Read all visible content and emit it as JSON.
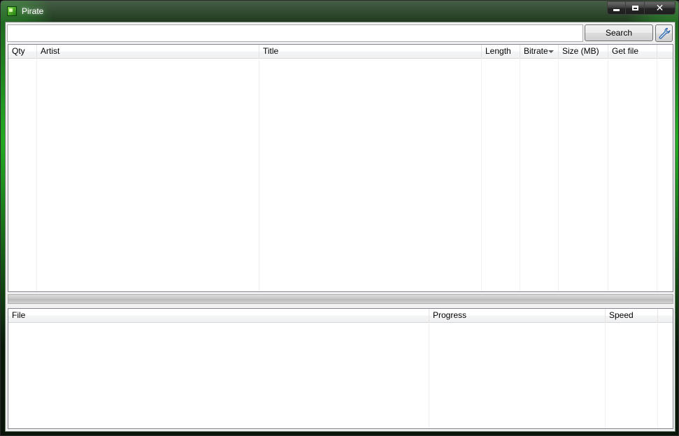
{
  "window": {
    "title": "Pirate",
    "accent_color": "#1f7a12",
    "icon": "app-icon"
  },
  "caption_buttons": {
    "minimize_icon": "minimize-icon",
    "maximize_icon": "maximize-icon",
    "close_label": "✕"
  },
  "search": {
    "value": "",
    "placeholder": "",
    "button_label": "Search",
    "settings_icon": "wrench-icon"
  },
  "results": {
    "columns": [
      "Qty",
      "Artist",
      "Title",
      "Length",
      "Bitrate",
      "Size (MB)",
      "Get file"
    ],
    "sorted_column": "Bitrate",
    "sort_direction": "descending",
    "rows": []
  },
  "downloads": {
    "columns": [
      "File",
      "Progress",
      "Speed"
    ],
    "rows": []
  }
}
